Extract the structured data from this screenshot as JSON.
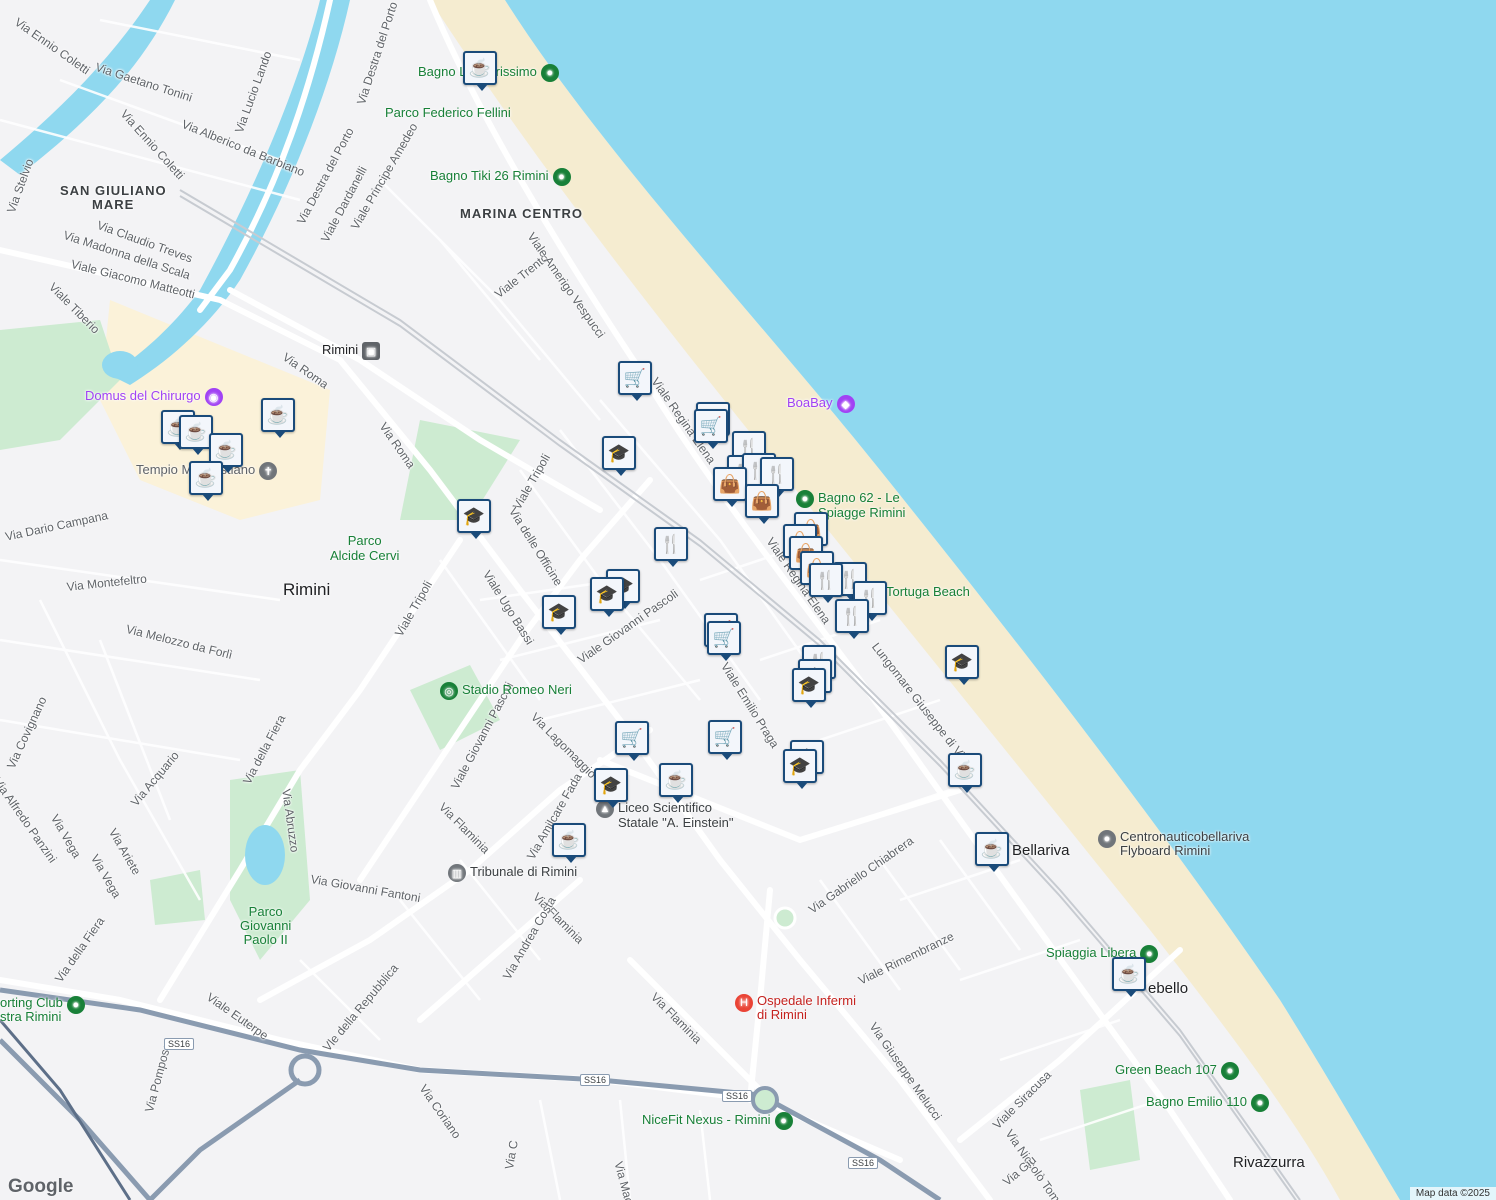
{
  "areas": {
    "san_giuliano": "SAN GIULIANO",
    "mare": "MARE",
    "marina_centro": "MARINA CENTRO",
    "rimini": "Rimini",
    "bellariva": "Bellariva",
    "rivazzurra": "Rivazzurra",
    "rebello": "ebello"
  },
  "streets": {
    "s1": "Via Ennio Coletti",
    "s2": "Via Gaetano Tonini",
    "s3": "Via Lucio Lando",
    "s4": "Via Alberico da Barbiano",
    "s5": "Via Ennio Coletti",
    "s6": "Via Destra del Porto",
    "s7": "Via Destra del Porto",
    "s8": "Via Stelvio",
    "s9": "Viale Dardanelli",
    "s10": "Viale Principe Amedeo",
    "s11": "Via Claudio Treves",
    "s12": "Via Madonna della Scala",
    "s13": "Viale Giacomo Matteotti",
    "s14": "Viale Tiberio",
    "s15": "Viale Trento",
    "s16": "Viale Amerigo Vespucci",
    "s17": "Via Roma",
    "s18": "Via Roma",
    "s19": "Viale Regina Elena",
    "s20": "Via Dario Campana",
    "s21": "Via Montefeltro",
    "s22": "Via Melozzo da Forlì",
    "s23": "Viale Tripoli",
    "s24": "Viale Tripoli",
    "s25": "Via delle Officine",
    "s26": "Viale Ugo Bassi",
    "s27": "Viale Giovanni Pascoli",
    "s28": "Viale Emilio Praga",
    "s29": "Lungomare Giuseppe di Vittorio",
    "s30": "Viale Regina Elena",
    "s31": "Via Covignano",
    "s32": "Via della Fiera",
    "s33": "Via Acquario",
    "s34": "Via Alfredo Panzini",
    "s35": "Via Vega",
    "s36": "Via Ariete",
    "s37": "Via Vega",
    "s38": "Via Abruzzo",
    "s39": "Viale Giovanni Pascoli",
    "s40": "Via Lagomaggio",
    "s41": "Via Flaminia",
    "s42": "Via Amilcare Fada",
    "s43": "Via Giovanni Fantoni",
    "s44": "Via Flaminia",
    "s45": "Via Andrea Costa",
    "s46": "Via Flaminia",
    "s47": "Via della Fiera",
    "s48": "Viale Euterpe",
    "s49": "Vle della Repubblica",
    "s50": "Via Gabriello Chiabrera",
    "s51": "Viale Rimembranze",
    "s52": "Via Giuseppe Melucci",
    "s53": "Viale Siracusa",
    "s54": "Via Niccolò Tommaseo",
    "s55": "Via Pomposa",
    "s56": "Via Coriano",
    "s57": "Via Macanno",
    "s58": "Via Giu",
    "s59": "Via C"
  },
  "road_badges": [
    "SS16",
    "SS16",
    "SS16",
    "SS16"
  ],
  "pois": {
    "bagno_amarissimo": "Bagno L'Amarissimo",
    "parco_fellini": "Parco Federico Fellini",
    "bagno_tiki": "Bagno Tiki 26 Rimini",
    "rimini_station": "Rimini",
    "domus": "Domus del Chirurgo",
    "tempio": "Tempio Malatestiano",
    "boabay": "BoaBay",
    "bagno62_a": "Bagno 62 - Le",
    "bagno62_b": "Spiagge Rimini",
    "parco_cervi_a": "Parco",
    "parco_cervi_b": "Alcide Cervi",
    "tortuga": "Tortuga Beach",
    "stadio": "Stadio Romeo Neri",
    "liceo_a": "Liceo Scientifico",
    "liceo_b": "Statale \"A. Einstein\"",
    "centronautico_a": "Centronauticobellariva",
    "centronautico_b": "Flyboard Rimini",
    "tribunale": "Tribunale di Rimini",
    "parco_gp_a": "Parco",
    "parco_gp_b": "Giovanni",
    "parco_gp_c": "Paolo II",
    "spiaggia_libera": "Spiaggia Libera",
    "ospedale_a": "Ospedale Infermi",
    "ospedale_b": "di Rimini",
    "sporting_a": "orting Club",
    "sporting_b": "stra Rimini",
    "green_beach": "Green Beach 107",
    "bagno_emilio": "Bagno Emilio 110",
    "nicefit": "NiceFit Nexus - Rimini"
  },
  "icons": {
    "cafe": "coffee-cup-icon",
    "grocery": "shopping-cart-icon",
    "restaurant": "fork-knife-icon",
    "shop": "shopping-bag-icon",
    "school": "graduation-cap-icon",
    "beach": "umbrella-icon",
    "park": "tree-icon",
    "hospital": "hospital-icon",
    "train": "train-icon"
  },
  "colors": {
    "sea": "#8fd8ef",
    "beach": "#f5ecd0",
    "land": "#f3f3f5",
    "park": "#cdebd1",
    "highway": "#8a9bb0",
    "marker_border": "#1a4b7a"
  },
  "attribution": "Map data ©2025",
  "logo": "Google"
}
